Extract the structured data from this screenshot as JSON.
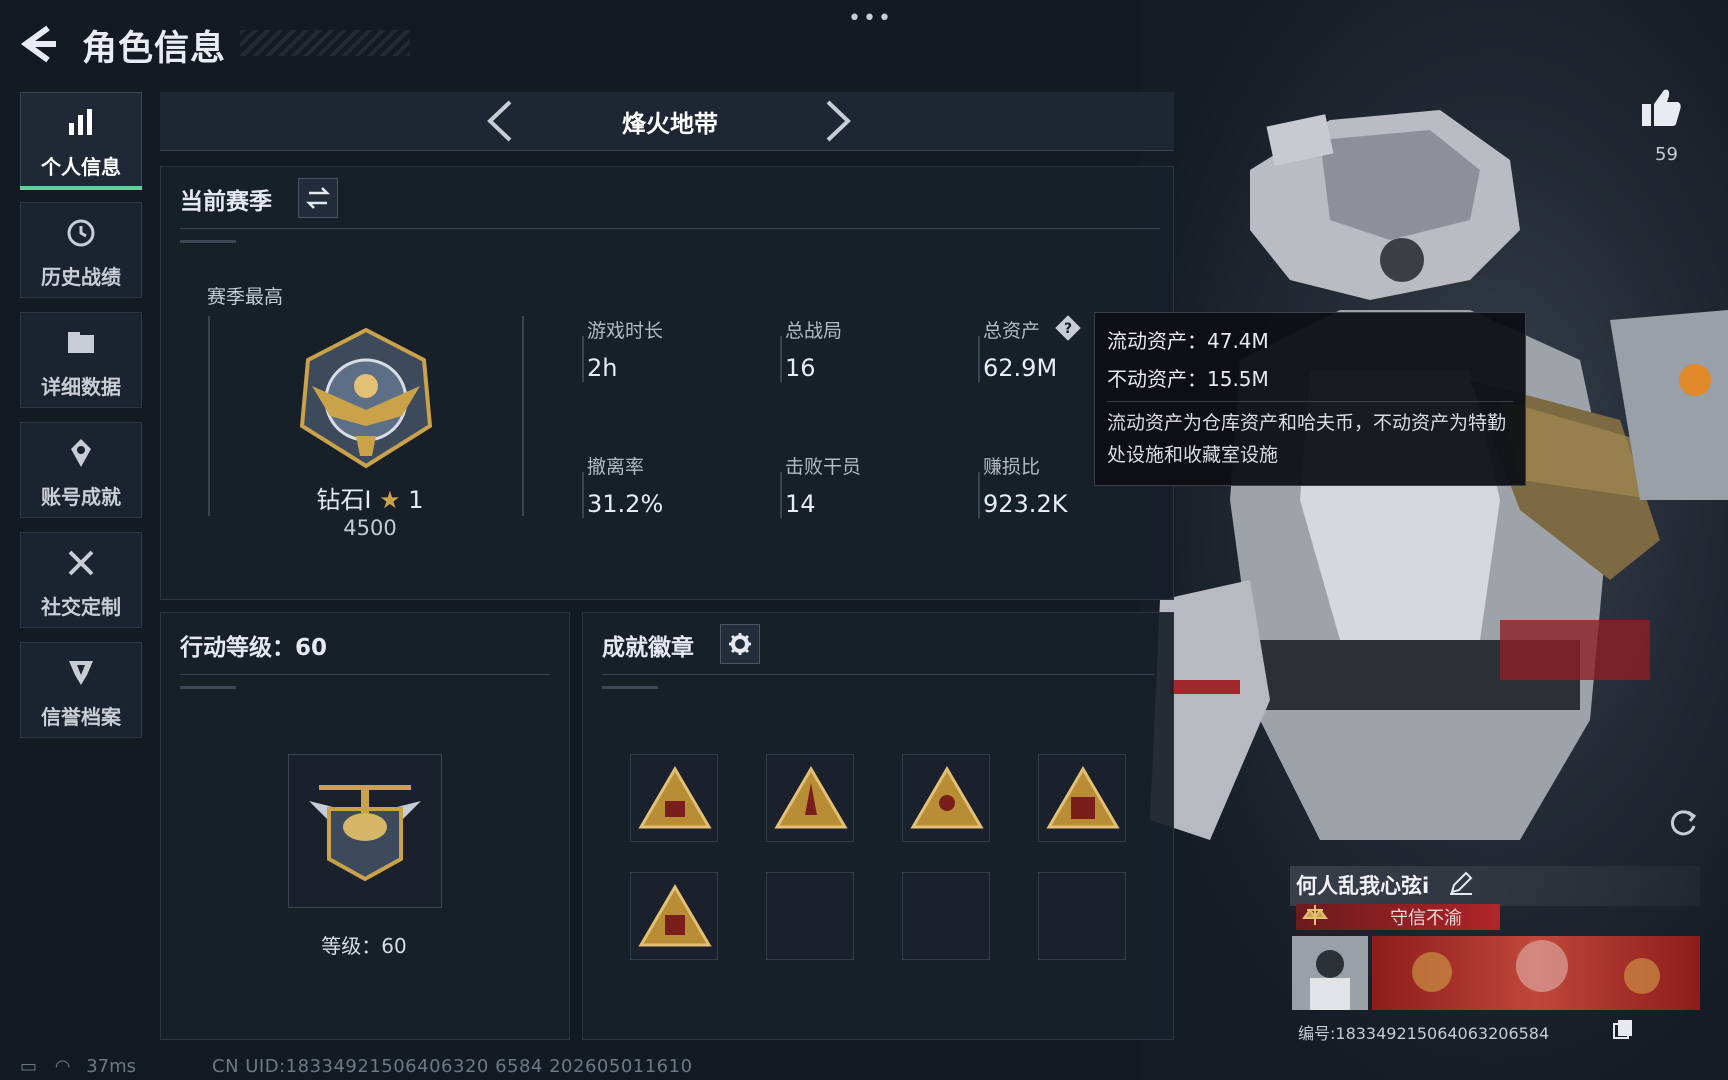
{
  "header": {
    "title": "角色信息"
  },
  "nav": {
    "items": [
      {
        "label": "个人信息",
        "icon": "bar-chart-icon"
      },
      {
        "label": "历史战绩",
        "icon": "history-icon"
      },
      {
        "label": "详细数据",
        "icon": "folder-icon"
      },
      {
        "label": "账号成就",
        "icon": "achievement-icon"
      },
      {
        "label": "社交定制",
        "icon": "tools-icon"
      },
      {
        "label": "信誉档案",
        "icon": "shield-icon"
      }
    ],
    "active_index": 0
  },
  "mode": {
    "label": "烽火地带"
  },
  "season": {
    "title": "当前赛季",
    "best_label": "赛季最高",
    "rank_name": "钻石I",
    "rank_stars": "1",
    "rank_score": "4500",
    "stats": [
      {
        "label": "游戏时长",
        "value": "2h"
      },
      {
        "label": "总战局",
        "value": "16"
      },
      {
        "label": "总资产",
        "value": "62.9M"
      },
      {
        "label": "撤离率",
        "value": "31.2%"
      },
      {
        "label": "击败干员",
        "value": "14"
      },
      {
        "label": "赚损比",
        "value": "923.2K"
      }
    ]
  },
  "tooltip": {
    "liquid": "流动资产：47.4M",
    "fixed": "不动资产：15.5M",
    "note": "流动资产为仓库资产和哈夫币，不动资产为特勤处设施和收藏室设施"
  },
  "action_level": {
    "title": "行动等级：60",
    "level_text": "等级：60"
  },
  "badges": {
    "title": "成就徽章",
    "filled_count": 5,
    "total_slots": 8
  },
  "profile": {
    "name": "何人乱我心弦i",
    "credit_tag": "守信不渝",
    "id_text": "编号:183349215064063206584",
    "likes": "59"
  },
  "footer": {
    "ping": "37ms",
    "uid_line": "CN UID:18334921506406320 6584 202605011610"
  },
  "colors": {
    "accent_green": "#5fd19a",
    "gold": "#c9a24a",
    "credit_red": "#b0252a"
  }
}
